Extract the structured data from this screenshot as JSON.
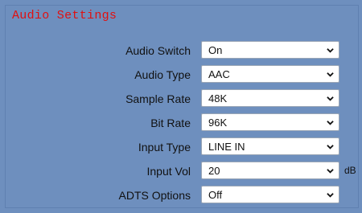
{
  "panel": {
    "title": "Audio Settings"
  },
  "fields": [
    {
      "label": "Audio Switch",
      "value": "On"
    },
    {
      "label": "Audio Type",
      "value": "AAC"
    },
    {
      "label": "Sample Rate",
      "value": "48K"
    },
    {
      "label": "Bit Rate",
      "value": "96K"
    },
    {
      "label": "Input Type",
      "value": "LINE IN"
    },
    {
      "label": "Input Vol",
      "value": "20",
      "unit": "dB"
    },
    {
      "label": "ADTS Options",
      "value": "Off"
    }
  ],
  "colors": {
    "background": "#6e8fbe",
    "title": "#e01010"
  },
  "icons": {
    "dropdown": "chevron-down-icon"
  }
}
